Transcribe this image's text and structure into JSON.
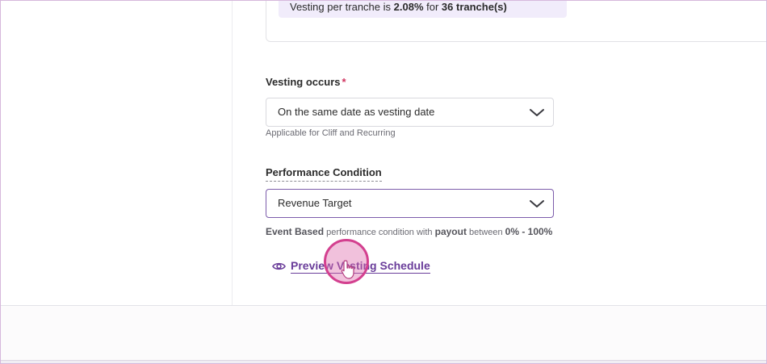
{
  "vesting_summary": {
    "prefix": "Vesting per tranche is ",
    "percent": "2.08%",
    "middle": " for ",
    "tranches": "36 tranche(s)"
  },
  "vesting_occurs": {
    "label": "Vesting occurs",
    "required_mark": "*",
    "selected_value": "On the same date as vesting date",
    "help_text": "Applicable for Cliff and Recurring",
    "chevron_icon": "chevron-down-icon"
  },
  "performance_condition": {
    "label": "Performance Condition",
    "selected_value": "Revenue Target",
    "chevron_icon": "chevron-down-icon",
    "description": {
      "type": "Event Based",
      "text1": " performance condition with ",
      "payout": "payout",
      "text2": " between ",
      "range": "0% - 100%"
    }
  },
  "preview_link": {
    "label": "Preview Vesting Schedule",
    "icon": "eye-icon"
  },
  "colors": {
    "accent": "#6a3d9a",
    "required": "#d0345f",
    "banner_bg": "#f1ecfb",
    "click_indicator": "#d3408f"
  }
}
